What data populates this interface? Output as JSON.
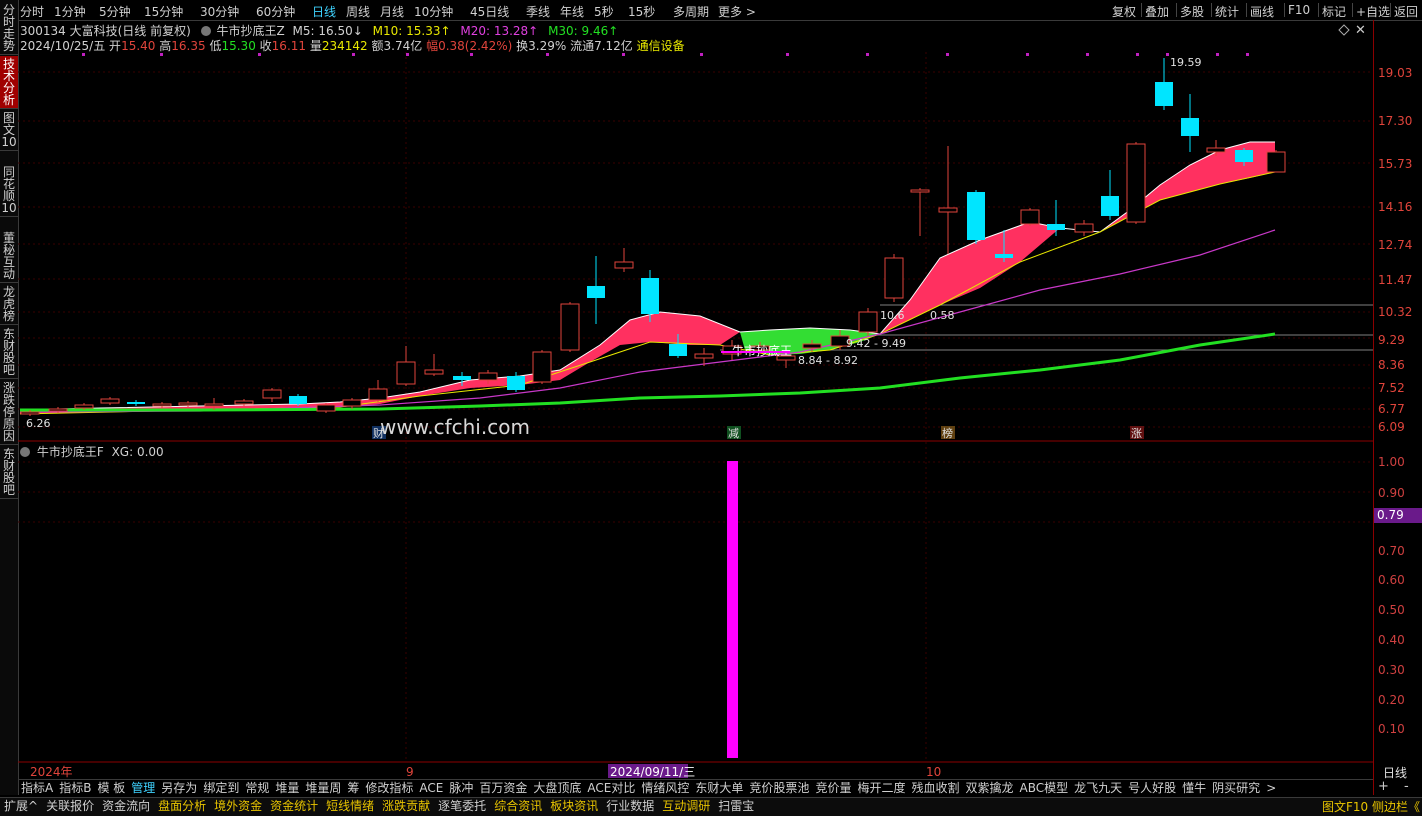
{
  "topbar": {
    "window_icon": "window-icon",
    "periods": [
      "分时",
      "1分钟",
      "5分钟",
      "15分钟",
      "30分钟",
      "60分钟",
      "日线",
      "周线",
      "月线",
      "10分钟",
      "45日线",
      "季线",
      "年线",
      "5秒",
      "15秒",
      "多周期",
      "更多 >"
    ],
    "active_period": "日线",
    "right_buttons": [
      "复权",
      "叠加",
      "多股",
      "统计",
      "画线",
      "F10",
      "标记",
      "+自选",
      "返回"
    ]
  },
  "sidebar": {
    "tabs": [
      "分时走势",
      "技术分析",
      "图文10",
      "同花顺10",
      "董秘互动",
      "龙虎榜",
      "东财股吧",
      "涨跌停原因",
      "东财股吧"
    ],
    "active_tab": "技术分析"
  },
  "header": {
    "stock": "300134 大富科技(日线 前复权)",
    "indicator_name": "牛市抄底王Z",
    "m5": "M5: 16.50↓",
    "m10": "M10: 15.33↑",
    "m20": "M20: 13.28↑",
    "m30": "M30: 9.46↑",
    "date": "2024/10/25/五",
    "open_label": "开",
    "open_val": "15.40",
    "high_label": "高",
    "high_val": "16.35",
    "low_label": "低",
    "low_val": "15.30",
    "close_label": "收",
    "close_val": "16.11",
    "vol_label": "量",
    "vol_val": "234142",
    "amt": "额3.74亿",
    "change": "幅0.38(2.42%)",
    "turnover": "换3.29%",
    "float": "流通7.12亿",
    "sector": "通信设备"
  },
  "main_chart": {
    "y_ticks": [
      "19.03",
      "17.30",
      "15.73",
      "14.16",
      "12.74",
      "11.47",
      "10.32",
      "9.29",
      "8.36",
      "7.52",
      "6.77",
      "6.09"
    ],
    "annotations": {
      "high": "19.59",
      "low": "6.26",
      "range1": "8.84 - 8.92",
      "range2": "9.42 - 9.49",
      "range3_left": "10.6",
      "range3_right": "0.58",
      "signal_label": "牛市抄底王"
    },
    "event_tags": [
      "财",
      "减",
      "榜",
      "涨"
    ],
    "watermark": "www.cfchi.com"
  },
  "sub_chart": {
    "title": "牛市抄底王F",
    "xg": "XG: 0.00",
    "y_ticks": [
      "1.00",
      "0.90",
      "0.70",
      "0.60",
      "0.50",
      "0.40",
      "0.30",
      "0.20",
      "0.10"
    ],
    "current_value": "0.79"
  },
  "x_axis": {
    "labels": [
      "2024年",
      "9",
      "10"
    ],
    "cursor_date": "2024/09/11/三",
    "period_label": "日线"
  },
  "bottom_tabs": [
    "指标A",
    "指标B",
    "模 板",
    "管理",
    "另存为",
    "绑定到",
    "常规",
    "堆量",
    "堆量周",
    "筹",
    "修改指标",
    "ACE",
    "脉冲",
    "百万资金",
    "大盘顶底",
    "ACE对比",
    "情绪风控",
    "东财大单",
    "竞价股票池",
    "竞价量",
    "梅开二度",
    "残血收割",
    "双紫擒龙",
    "ABC模型",
    "龙飞九天",
    "号人好股",
    "懂牛",
    "阴买研究",
    ">"
  ],
  "bottom_active": "管理",
  "status_bar": {
    "items": [
      "扩展^",
      "关联报价",
      "资金流向",
      "盘面分析",
      "境外资金",
      "资金统计",
      "短线情绪",
      "涨跌贡献",
      "逐笔委托",
      "综合资讯",
      "板块资讯",
      "行业数据",
      "互动调研",
      "扫雷宝"
    ],
    "right": "图文F10 侧边栏《",
    "plus": "+",
    "minus": "-"
  },
  "colors": {
    "up": "#e0443b",
    "down": "#00e5ff",
    "ma_green": "#22e022",
    "ma_magenta": "#c838c8",
    "band_red": "#ff3060",
    "band_green": "#33dd33",
    "signal": "#ff00ff",
    "accent": "#3fd3ff"
  }
}
